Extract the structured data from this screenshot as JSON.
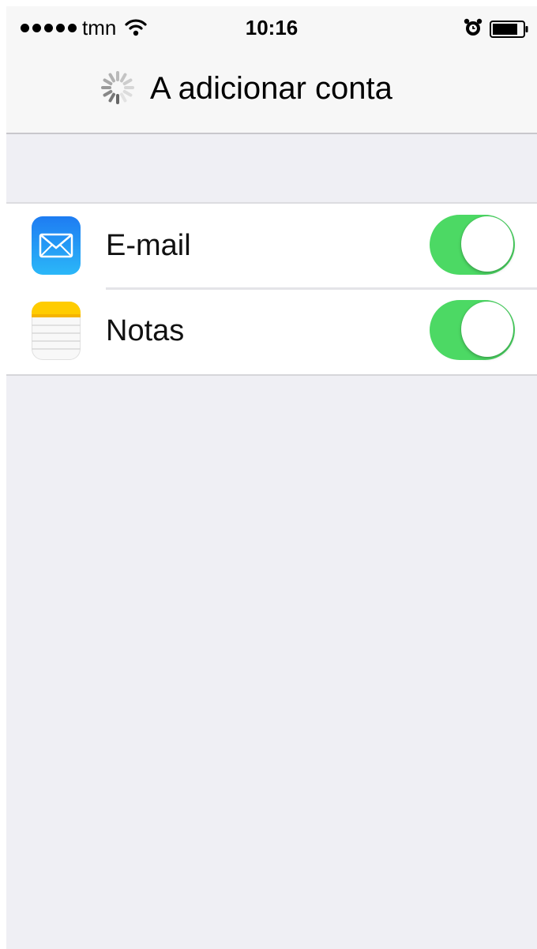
{
  "status_bar": {
    "carrier": "tmn",
    "time": "10:16",
    "icons": [
      "signal-dots-icon",
      "wifi-icon",
      "alarm-icon",
      "battery-icon"
    ]
  },
  "nav_bar": {
    "title": "A adicionar conta",
    "loading": true
  },
  "services": [
    {
      "label": "E-mail",
      "icon": "mail-icon",
      "enabled": true
    },
    {
      "label": "Notas",
      "icon": "notes-icon",
      "enabled": true
    }
  ],
  "colors": {
    "toggle_on": "#4cd964",
    "background": "#efeff4",
    "mail_icon": "#1e7cf2",
    "notes_icon_top": "#ffcc00"
  }
}
